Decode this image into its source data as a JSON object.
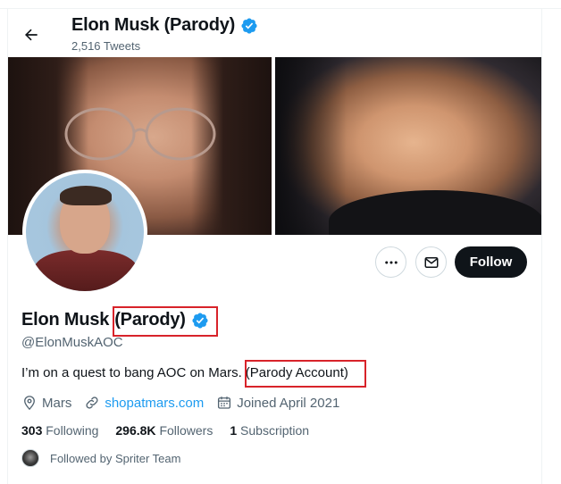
{
  "header": {
    "name": "Elon Musk (Parody)",
    "tweets": "2,516 Tweets"
  },
  "profile": {
    "name_main": "Elon Musk",
    "name_parody": "(Parody)",
    "handle": "@ElonMuskAOC",
    "bio_main": "I’m on a quest to bang AOC on Mars.",
    "bio_parody": "(Parody Account)",
    "location": "Mars",
    "website": "shopatmars.com",
    "joined": "Joined April 2021"
  },
  "actions": {
    "follow_label": "Follow"
  },
  "stats": {
    "following_count": "303",
    "following_label": "Following",
    "followers_count": "296.8K",
    "followers_label": "Followers",
    "subscriptions_count": "1",
    "subscriptions_label": "Subscription"
  },
  "followed_by": "Followed by Spriter Team",
  "colors": {
    "verified": "#1d9bf0",
    "link": "#1d9bf0",
    "highlight_box": "#d8232a"
  },
  "icons": [
    "back-arrow-icon",
    "verified-badge-icon",
    "more-icon",
    "mail-icon",
    "location-icon",
    "link-icon",
    "calendar-icon"
  ]
}
